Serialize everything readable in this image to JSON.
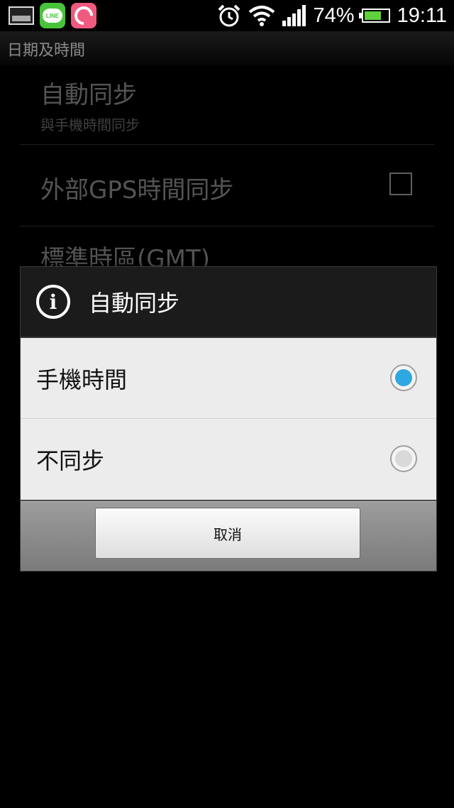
{
  "status_bar": {
    "battery_percent": "74%",
    "battery_level": 0.74,
    "time": "19:11",
    "icons": [
      "image-notification-icon",
      "line-app-icon",
      "c-app-icon",
      "alarm-icon",
      "wifi-icon",
      "signal-icon",
      "battery-icon"
    ],
    "line_label": "LINE"
  },
  "header": {
    "title": "日期及時間"
  },
  "settings": {
    "auto_sync": {
      "title": "自動同步",
      "subtitle": "與手機時間同步"
    },
    "gps_sync": {
      "title": "外部GPS時間同步",
      "checked": false
    },
    "timezone": {
      "title": "標準時區(GMT)"
    }
  },
  "dialog": {
    "title": "自動同步",
    "icon": "info-icon",
    "options": [
      {
        "label": "手機時間",
        "selected": true
      },
      {
        "label": "不同步",
        "selected": false
      }
    ],
    "cancel_label": "取消"
  },
  "colors": {
    "radio_selected": "#2fa7e0",
    "battery_fill": "#5fd13a",
    "line_green": "#49c33b",
    "c_app_pink": "#f05a7e"
  }
}
